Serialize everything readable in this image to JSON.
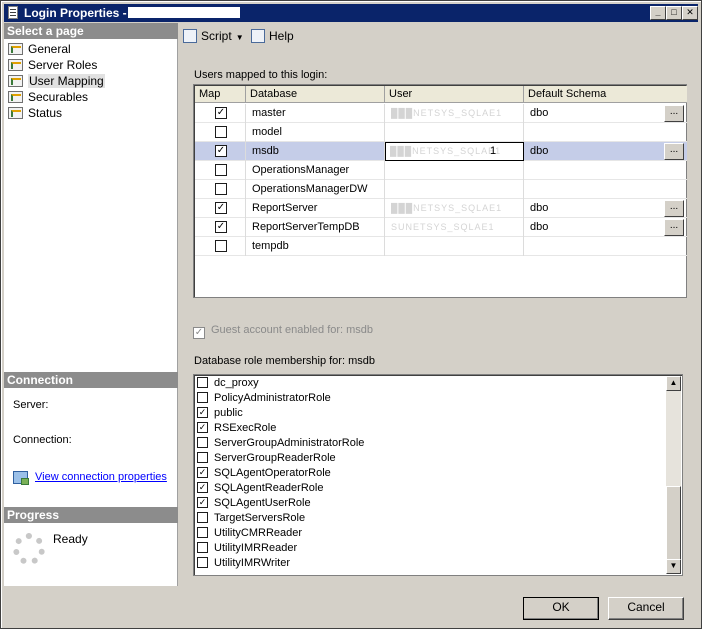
{
  "window": {
    "title": "Login Properties - "
  },
  "left_pane": {
    "select_page_header": "Select a page",
    "pages": [
      {
        "label": "General",
        "icon": "page-icon"
      },
      {
        "label": "Server Roles",
        "icon": "page-icon"
      },
      {
        "label": "User Mapping",
        "icon": "page-icon"
      },
      {
        "label": "Securables",
        "icon": "page-icon"
      },
      {
        "label": "Status",
        "icon": "page-icon"
      }
    ],
    "connection_header": "Connection",
    "server_label": "Server:",
    "connection_label": "Connection:",
    "view_connection_link": "View connection properties",
    "progress_header": "Progress",
    "progress_status": "Ready"
  },
  "toolbar": {
    "script_label": "Script",
    "help_label": "Help"
  },
  "user_mapping": {
    "users_mapped_label": "Users mapped to this login:",
    "columns": [
      "Map",
      "Database",
      "User",
      "Default Schema"
    ],
    "rows": [
      {
        "map": true,
        "database": "master",
        "user": "███NETSYS_SQLAE1",
        "schema": "dbo",
        "has_button": true
      },
      {
        "map": false,
        "database": "model",
        "user": "",
        "schema": "",
        "has_button": false
      },
      {
        "map": true,
        "database": "msdb",
        "user": "███NETSYS_SQLAE1",
        "schema": "dbo",
        "has_button": true,
        "selected": true
      },
      {
        "map": false,
        "database": "OperationsManager",
        "user": "",
        "schema": "",
        "has_button": false
      },
      {
        "map": false,
        "database": "OperationsManagerDW",
        "user": "",
        "schema": "",
        "has_button": false
      },
      {
        "map": true,
        "database": "ReportServer",
        "user": "███NETSYS_SQLAE1",
        "schema": "dbo",
        "has_button": true
      },
      {
        "map": true,
        "database": "ReportServerTempDB",
        "user": "SUNETSYS_SQLAE1",
        "schema": "dbo",
        "has_button": true
      },
      {
        "map": false,
        "database": "tempdb",
        "user": "",
        "schema": "",
        "has_button": false
      }
    ],
    "ellipsis": "...",
    "guest_account_label": "Guest account enabled for: msdb",
    "role_membership_label": "Database role membership for: msdb",
    "roles": [
      {
        "name": "dc_proxy",
        "checked": false
      },
      {
        "name": "PolicyAdministratorRole",
        "checked": false
      },
      {
        "name": "public",
        "checked": true
      },
      {
        "name": "RSExecRole",
        "checked": true
      },
      {
        "name": "ServerGroupAdministratorRole",
        "checked": false
      },
      {
        "name": "ServerGroupReaderRole",
        "checked": false
      },
      {
        "name": "SQLAgentOperatorRole",
        "checked": true
      },
      {
        "name": "SQLAgentReaderRole",
        "checked": true
      },
      {
        "name": "SQLAgentUserRole",
        "checked": true
      },
      {
        "name": "TargetServersRole",
        "checked": false
      },
      {
        "name": "UtilityCMRReader",
        "checked": false
      },
      {
        "name": "UtilityIMRReader",
        "checked": false
      },
      {
        "name": "UtilityIMRWriter",
        "checked": false
      }
    ]
  },
  "buttons": {
    "ok": "OK",
    "cancel": "Cancel"
  }
}
